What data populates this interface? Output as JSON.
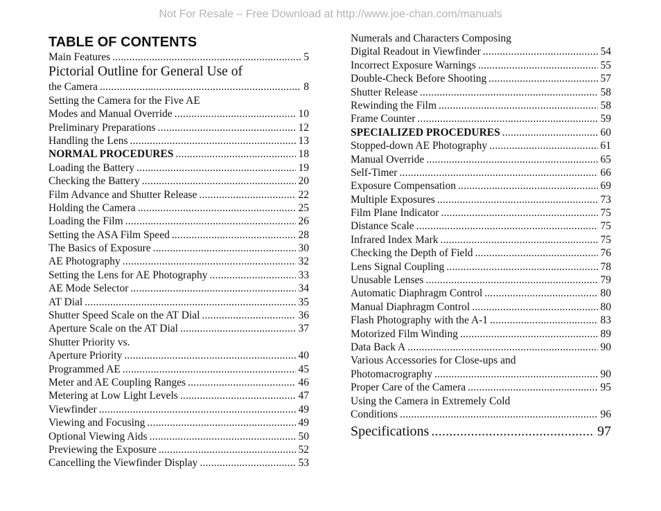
{
  "watermark": "Not For Resale – Free Download at http://www.joe-chan.com/manuals",
  "toc_heading": "TABLE OF CONTENTS",
  "left_column": [
    {
      "title": "Main Features",
      "page": "5"
    },
    {
      "title": "Pictorial Outline for General Use of",
      "page": "",
      "style": "big"
    },
    {
      "title": "the Camera",
      "page": "8"
    },
    {
      "title": "Setting the Camera for the Five AE",
      "page": ""
    },
    {
      "title": "Modes and Manual Override",
      "page": "10"
    },
    {
      "title": "Preliminary Preparations",
      "page": "12"
    },
    {
      "title": "Handling the Lens",
      "page": "13"
    },
    {
      "title": "NORMAL PROCEDURES",
      "page": "18",
      "style": "bold"
    },
    {
      "title": "Loading the Battery",
      "page": "19"
    },
    {
      "title": "Checking the Battery",
      "page": "20"
    },
    {
      "title": "Film Advance and Shutter Release",
      "page": "22"
    },
    {
      "title": "Holding the Camera",
      "page": "25"
    },
    {
      "title": "Loading the Film",
      "page": "26"
    },
    {
      "title": "Setting the ASA Film Speed",
      "page": "28"
    },
    {
      "title": "The Basics of Exposure",
      "page": "30"
    },
    {
      "title": "AE Photography",
      "page": "32"
    },
    {
      "title": "Setting the Lens for AE Photography",
      "page": "33"
    },
    {
      "title": "AE Mode Selector",
      "page": "34"
    },
    {
      "title": "AT Dial",
      "page": "35"
    },
    {
      "title": "Shutter Speed Scale on the AT Dial",
      "page": "36"
    },
    {
      "title": "Aperture Scale on the AT Dial",
      "page": "37"
    },
    {
      "title": "Shutter Priority vs.",
      "page": ""
    },
    {
      "title": "Aperture Priority",
      "page": "40"
    },
    {
      "title": "Programmed AE",
      "page": "45"
    },
    {
      "title": "Meter and AE Coupling Ranges",
      "page": "46"
    },
    {
      "title": "Metering at Low Light Levels",
      "page": "47"
    },
    {
      "title": "Viewfinder",
      "page": "49"
    },
    {
      "title": "Viewing and Focusing",
      "page": "49"
    },
    {
      "title": "Optional Viewing Aids",
      "page": "50"
    },
    {
      "title": "Previewing the Exposure",
      "page": "52"
    },
    {
      "title": "Cancelling the Viewfinder Display",
      "page": "53"
    }
  ],
  "right_column": [
    {
      "title": "Numerals and Characters Composing",
      "page": ""
    },
    {
      "title": "Digital Readout in Viewfinder",
      "page": "54"
    },
    {
      "title": "Incorrect Exposure Warnings",
      "page": "55"
    },
    {
      "title": "Double-Check Before Shooting",
      "page": "57"
    },
    {
      "title": "Shutter Release",
      "page": "58"
    },
    {
      "title": "Rewinding the Film",
      "page": "58"
    },
    {
      "title": "Frame Counter",
      "page": "59"
    },
    {
      "title": "SPECIALIZED PROCEDURES",
      "page": "60",
      "style": "bold"
    },
    {
      "title": "Stopped-down AE Photography",
      "page": "61"
    },
    {
      "title": "Manual Override",
      "page": "65"
    },
    {
      "title": "Self-Timer",
      "page": "66"
    },
    {
      "title": "Exposure Compensation",
      "page": "69"
    },
    {
      "title": "Multiple Exposures",
      "page": "73"
    },
    {
      "title": "Film Plane Indicator",
      "page": "75"
    },
    {
      "title": "Distance Scale",
      "page": "75"
    },
    {
      "title": "Infrared Index Mark",
      "page": "75"
    },
    {
      "title": "Checking the Depth of Field",
      "page": "76"
    },
    {
      "title": "Lens Signal Coupling",
      "page": "78"
    },
    {
      "title": "Unusable Lenses",
      "page": "79"
    },
    {
      "title": "Automatic Diaphragm Control",
      "page": "80"
    },
    {
      "title": "Manual Diaphragm Control",
      "page": "80"
    },
    {
      "title": "Flash Photography with the A-1",
      "page": "83"
    },
    {
      "title": "Motorized Film Winding",
      "page": "89"
    },
    {
      "title": "Data Back A",
      "page": "90"
    },
    {
      "title": "Various Accessories for Close-ups and",
      "page": ""
    },
    {
      "title": "Photomacrography",
      "page": "90"
    },
    {
      "title": "Proper Care of the Camera",
      "page": "95"
    },
    {
      "title": "Using the Camera in Extremely Cold",
      "page": ""
    },
    {
      "title": "Conditions",
      "page": "96"
    },
    {
      "title": "Specifications",
      "page": "97",
      "style": "bigentry"
    }
  ]
}
